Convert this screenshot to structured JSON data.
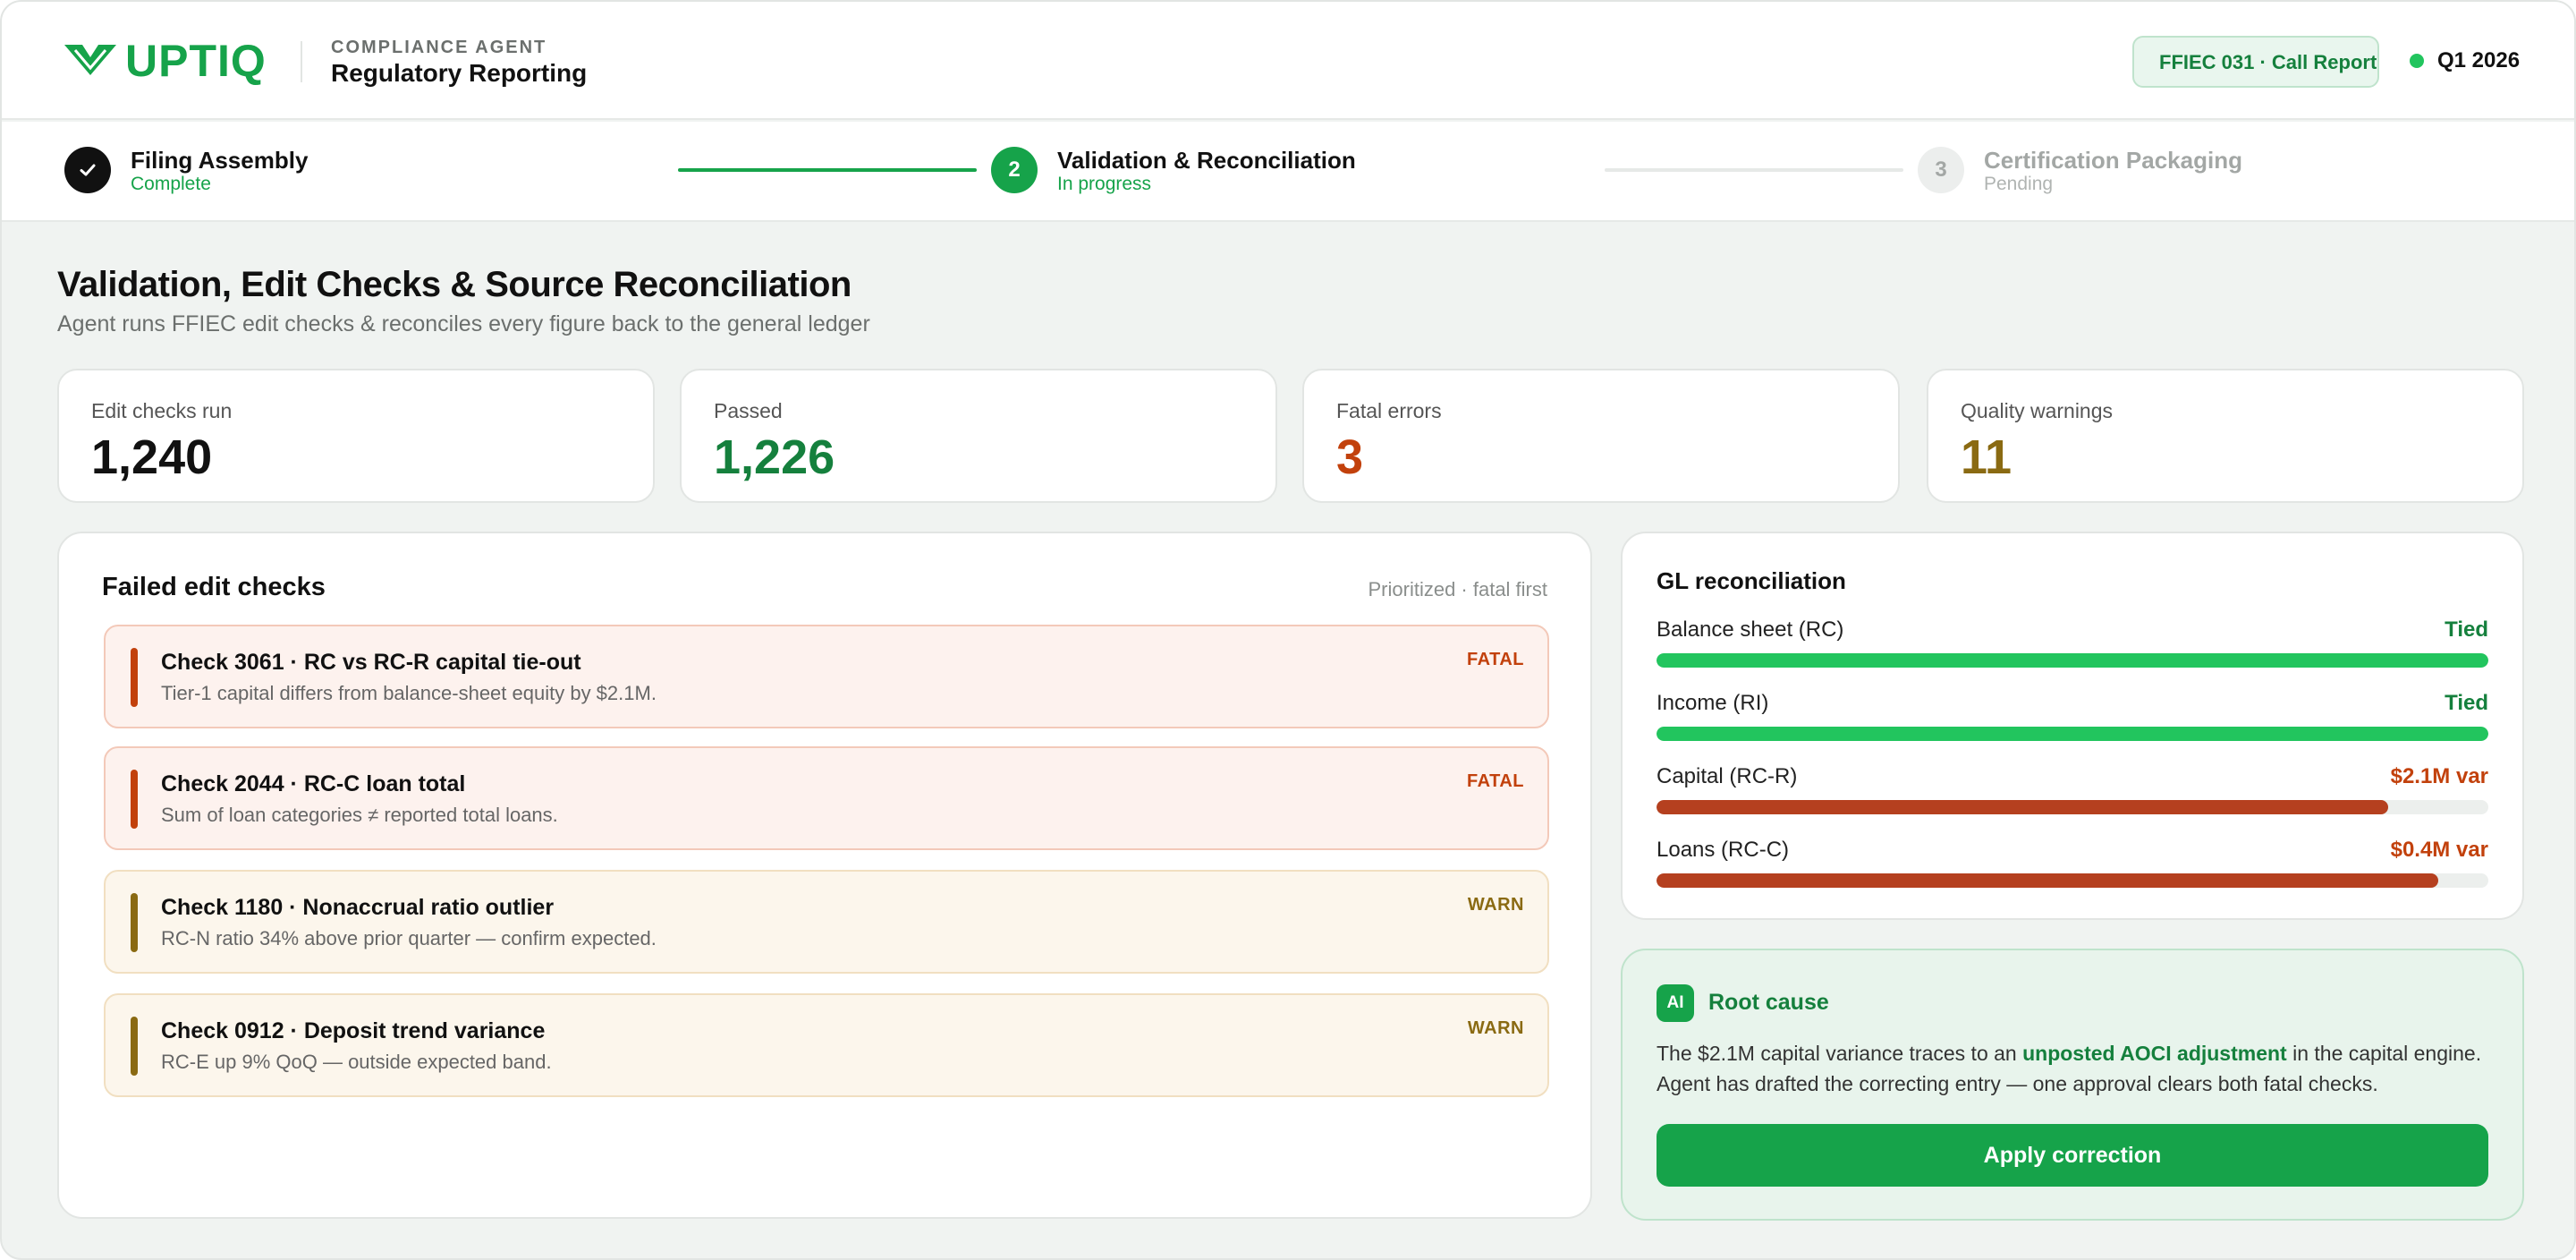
{
  "header": {
    "logo_text": "UPTIQ",
    "logo_icon": "uptiq-chevron-logo",
    "agent_kicker": "COMPLIANCE AGENT",
    "agent_title": "Regulatory Reporting",
    "form_badge": "FFIEC 031 · Call Report",
    "period": "Q1 2026",
    "status_color": "#22c55e"
  },
  "stepper": {
    "steps": [
      {
        "number": "1",
        "icon": "check-icon",
        "title": "Filing Assembly",
        "status": "Complete",
        "state": "complete"
      },
      {
        "number": "2",
        "title": "Validation & Reconciliation",
        "status": "In progress",
        "state": "active"
      },
      {
        "number": "3",
        "title": "Certification Packaging",
        "status": "Pending",
        "state": "pending"
      }
    ]
  },
  "page": {
    "title": "Validation, Edit Checks & Source Reconciliation",
    "subtitle": "Agent runs FFIEC edit checks & reconciles every figure back to the general ledger"
  },
  "kpis": [
    {
      "label": "Edit checks run",
      "value": "1,240",
      "color": "#111111"
    },
    {
      "label": "Passed",
      "value": "1,226",
      "color": "#15803d"
    },
    {
      "label": "Fatal errors",
      "value": "3",
      "color": "#c2410c"
    },
    {
      "label": "Quality warnings",
      "value": "11",
      "color": "#8a6a12"
    }
  ],
  "failed_checks": {
    "title": "Failed edit checks",
    "note": "Prioritized · fatal first",
    "items": [
      {
        "title": "Check 3061 · RC vs RC-R capital tie-out",
        "description": "Tier-1 capital differs from balance-sheet equity by $2.1M.",
        "severity": "FATAL",
        "kind": "fatal"
      },
      {
        "title": "Check 2044 · RC-C loan total",
        "description": "Sum of loan categories ≠ reported total loans.",
        "severity": "FATAL",
        "kind": "fatal"
      },
      {
        "title": "Check 1180 · Nonaccrual ratio outlier",
        "description": "RC-N ratio 34% above prior quarter — confirm expected.",
        "severity": "WARN",
        "kind": "warn"
      },
      {
        "title": "Check 0912 · Deposit trend variance",
        "description": "RC-E up 9% QoQ — outside expected band.",
        "severity": "WARN",
        "kind": "warn"
      }
    ]
  },
  "gl_reconciliation": {
    "title": "GL reconciliation",
    "items": [
      {
        "label": "Balance sheet (RC)",
        "status": "Tied",
        "tied": true,
        "fill_fraction": 1.0
      },
      {
        "label": "Income (RI)",
        "status": "Tied",
        "tied": true,
        "fill_fraction": 1.0
      },
      {
        "label": "Capital (RC-R)",
        "status": "$2.1M var",
        "tied": false,
        "fill_fraction": 0.88
      },
      {
        "label": "Loans (RC-C)",
        "status": "$0.4M var",
        "tied": false,
        "fill_fraction": 0.94
      }
    ]
  },
  "root_cause": {
    "badge": "AI",
    "title": "Root cause",
    "text_before": "The $2.1M capital variance traces to an ",
    "text_bold": "unposted AOCI adjustment",
    "text_after": " in the capital engine. Agent has drafted the correcting entry — one approval clears both fatal checks.",
    "button_label": "Apply correction"
  },
  "colors": {
    "accent": "#16a34a",
    "tied_bar": "#22c55e",
    "variance_bar": "#b5401f",
    "fatal": "#c2410c",
    "warn": "#8a6a12"
  }
}
